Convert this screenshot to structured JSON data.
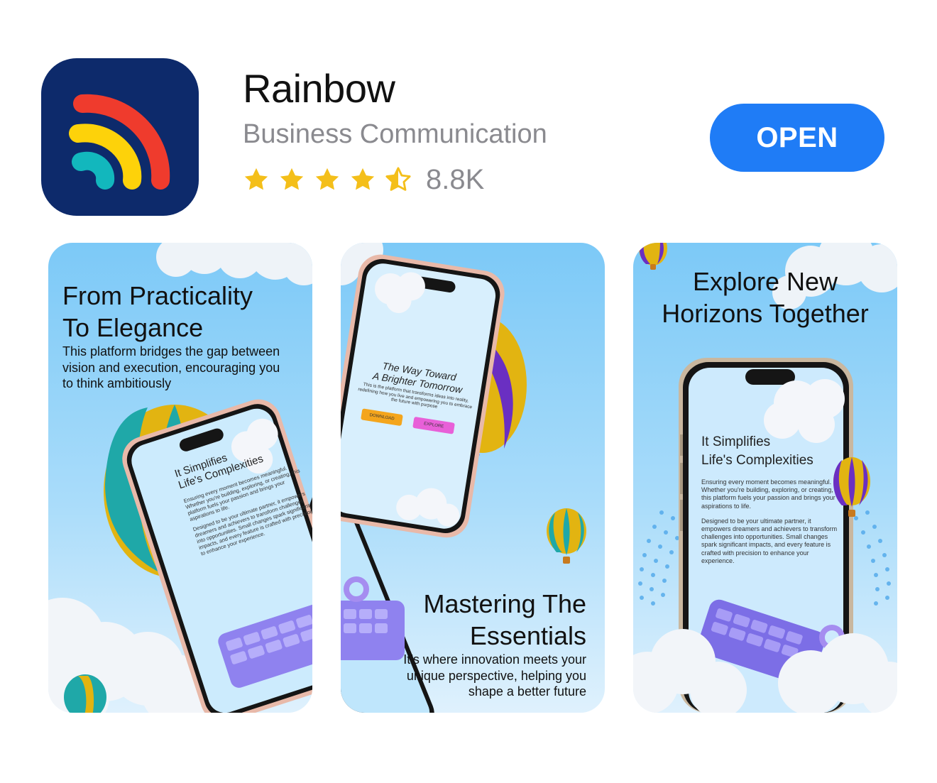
{
  "app": {
    "name": "Rainbow",
    "category": "Business Communication",
    "rating_stars": 4.5,
    "rating_count": "8.8K",
    "open_label": "OPEN",
    "icon": "rainbow-logo-icon",
    "colors": {
      "icon_bg": "#0d2a6b",
      "red": "#ef3b2d",
      "yellow": "#fdd20a",
      "teal": "#12b7bd",
      "button": "#1f7cf6",
      "star": "#f4bf1a"
    }
  },
  "screenshots": [
    {
      "title_line1": "From Practicality",
      "title_line2": "To Elegance",
      "body_line1": "This platform bridges the gap between",
      "body_line2": "vision and execution, encouraging you",
      "body_line3": "to think ambitiously",
      "phone": {
        "heading_line1": "It Simplifies",
        "heading_line2": "Life's Complexities",
        "para1": "Ensuring every moment becomes meaningful. Whether you're building, exploring, or creating, this platform fuels your passion and brings your aspirations to life.",
        "para2": "Designed to be your ultimate partner, it empowers dreamers and achievers to transform challenges into opportunities. Small changes spark significant impacts, and every feature is crafted with precision to enhance your experience."
      }
    },
    {
      "title_line1": "Mastering The",
      "title_line2": "Essentials",
      "body_line1": "It’s where innovation meets your",
      "body_line2": "unique perspective, helping you",
      "body_line3": "shape a better future",
      "phone": {
        "heading_line1": "The Way Toward",
        "heading_line2": "A Brighter Tomorrow",
        "para": "This is the platform that transforms ideas into reality, redefining how you live and empowering you to embrace the future with purpose",
        "button1": "DOWNLOAD",
        "button2": "EXPLORE"
      }
    },
    {
      "title_line1": "Explore New",
      "title_line2": "Horizons Together",
      "phone": {
        "heading_line1": "It Simplifies",
        "heading_line2": "Life's Complexities",
        "para1": "Ensuring every moment becomes meaningful. Whether you're building, exploring, or creating, this platform fuels your passion and brings your aspirations to life.",
        "para2": "Designed to be your ultimate partner, it empowers dreamers and achievers to transform challenges into opportunities. Small changes spark significant impacts, and every feature is crafted with precision to enhance your experience."
      }
    }
  ]
}
